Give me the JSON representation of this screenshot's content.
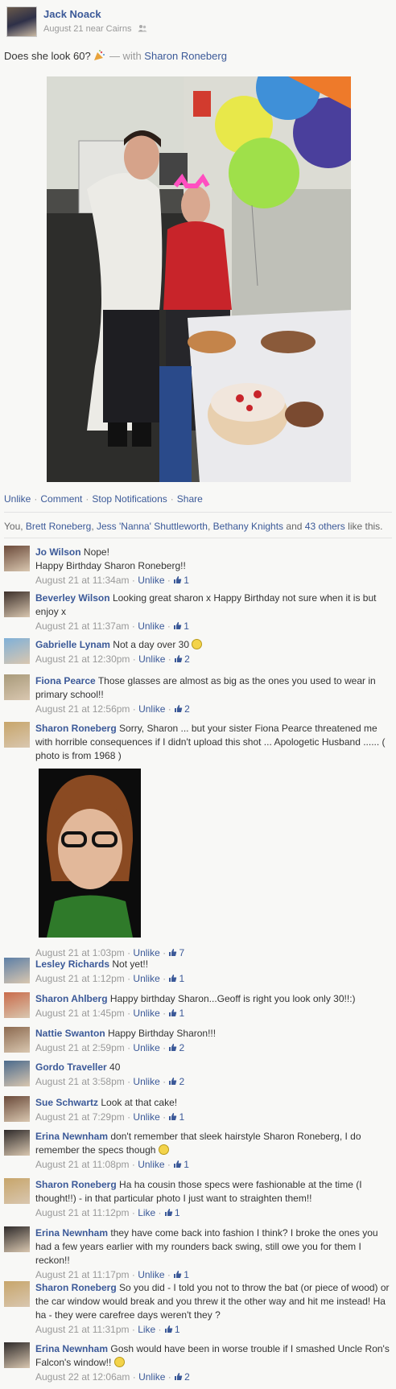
{
  "post": {
    "author": "Jack Noack",
    "meta": "August 21 near Cairns",
    "status_text": "Does she look 60?",
    "with_prefix": "— with",
    "with_name": "Sharon Roneberg",
    "actions": [
      "Unlike",
      "Comment",
      "Stop Notifications",
      "Share"
    ],
    "likes": {
      "names": [
        "You",
        "Brett Roneberg",
        "Jess 'Nanna' Shuttleworth",
        "Bethany Knights"
      ],
      "others": "43 others",
      "suffix": "like this."
    }
  },
  "comments": [
    {
      "name": "Jo Wilson",
      "text": "Nope!\nHappy Birthday Sharon Roneberg!!",
      "time": "August 21 at 11:34am",
      "action": "Unlike",
      "likes": "1",
      "avatar": "#6b4a3a"
    },
    {
      "name": "Beverley Wilson",
      "text": "Looking great sharon x Happy Birthday not sure when it is but enjoy x",
      "time": "August 21 at 11:37am",
      "action": "Unlike",
      "likes": "1",
      "avatar": "#3c2f2a"
    },
    {
      "name": "Gabrielle Lynam",
      "text": "Not a day over 30",
      "emoji": true,
      "time": "August 21 at 12:30pm",
      "action": "Unlike",
      "likes": "2",
      "avatar": "#7fb0d8"
    },
    {
      "name": "Fiona Pearce",
      "text": "Those glasses are almost as big as the ones you used to wear in primary school!!",
      "time": "August 21 at 12:56pm",
      "action": "Unlike",
      "likes": "2",
      "avatar": "#a89a7a"
    },
    {
      "name": "Sharon Roneberg",
      "text": "Sorry, Sharon ... but your sister Fiona Pearce threatened me with horrible consequences if I didn't upload this shot ... Apologetic Husband ...... ( photo is from 1968 )",
      "photo": true,
      "time": "August 21 at 1:03pm",
      "action": "Unlike",
      "likes": "7",
      "avatar": "#c7a56a"
    },
    {
      "name": "Lesley Richards",
      "text": "Not yet!!",
      "time": "August 21 at 1:12pm",
      "action": "Unlike",
      "likes": "1",
      "avatar": "#5d7fa6"
    },
    {
      "name": "Sharon Ahlberg",
      "text": "Happy birthday Sharon...Geoff is right you look only 30!!:)",
      "time": "August 21 at 1:45pm",
      "action": "Unlike",
      "likes": "1",
      "avatar": "#c96b4a"
    },
    {
      "name": "Nattie Swanton",
      "text": "Happy Birthday Sharon!!!",
      "time": "August 21 at 2:59pm",
      "action": "Unlike",
      "likes": "2",
      "avatar": "#8c6a50"
    },
    {
      "name": "Gordo Traveller",
      "text": "40",
      "time": "August 21 at 3:58pm",
      "action": "Unlike",
      "likes": "2",
      "avatar": "#4a6a8c"
    },
    {
      "name": "Sue Schwartz",
      "text": "Look at that cake!",
      "time": "August 21 at 7:29pm",
      "action": "Unlike",
      "likes": "1",
      "avatar": "#6a4a3a"
    },
    {
      "name": "Erina Newnham",
      "text": "don't remember that sleek hairstyle Sharon Roneberg, I do remember the specs though",
      "emoji": true,
      "time": "August 21 at 11:08pm",
      "action": "Unlike",
      "likes": "1",
      "avatar": "#2e2a2a"
    },
    {
      "name": "Sharon Roneberg",
      "text": "Ha ha cousin those specs were fashionable at the time (I thought!!) - in that particular photo I just want to straighten them!!",
      "time": "August 21 at 11:12pm",
      "action": "Like",
      "likes": "1",
      "avatar": "#c7a56a"
    },
    {
      "name": "Erina Newnham",
      "text": "they have come back into fashion I think? I broke the ones you had a few years earlier with my rounders back swing, still owe you for them I reckon!!",
      "time": "August 21 at 11:17pm",
      "action": "Unlike",
      "likes": "1",
      "avatar": "#2e2a2a"
    },
    {
      "name": "Sharon Roneberg",
      "text": "So you did - I told you not to throw the bat (or piece of wood) or the car window would break and you threw it the other way and hit me instead! Ha ha - they were carefree days weren't they ?",
      "time": "August 21 at 11:31pm",
      "action": "Like",
      "likes": "1",
      "avatar": "#c7a56a"
    },
    {
      "name": "Erina Newnham",
      "text": "Gosh would have been in worse trouble if I smashed Uncle Ron's Falcon's window!!",
      "emoji": true,
      "time": "August 22 at 12:06am",
      "action": "Unlike",
      "likes": "2",
      "avatar": "#2e2a2a"
    }
  ]
}
